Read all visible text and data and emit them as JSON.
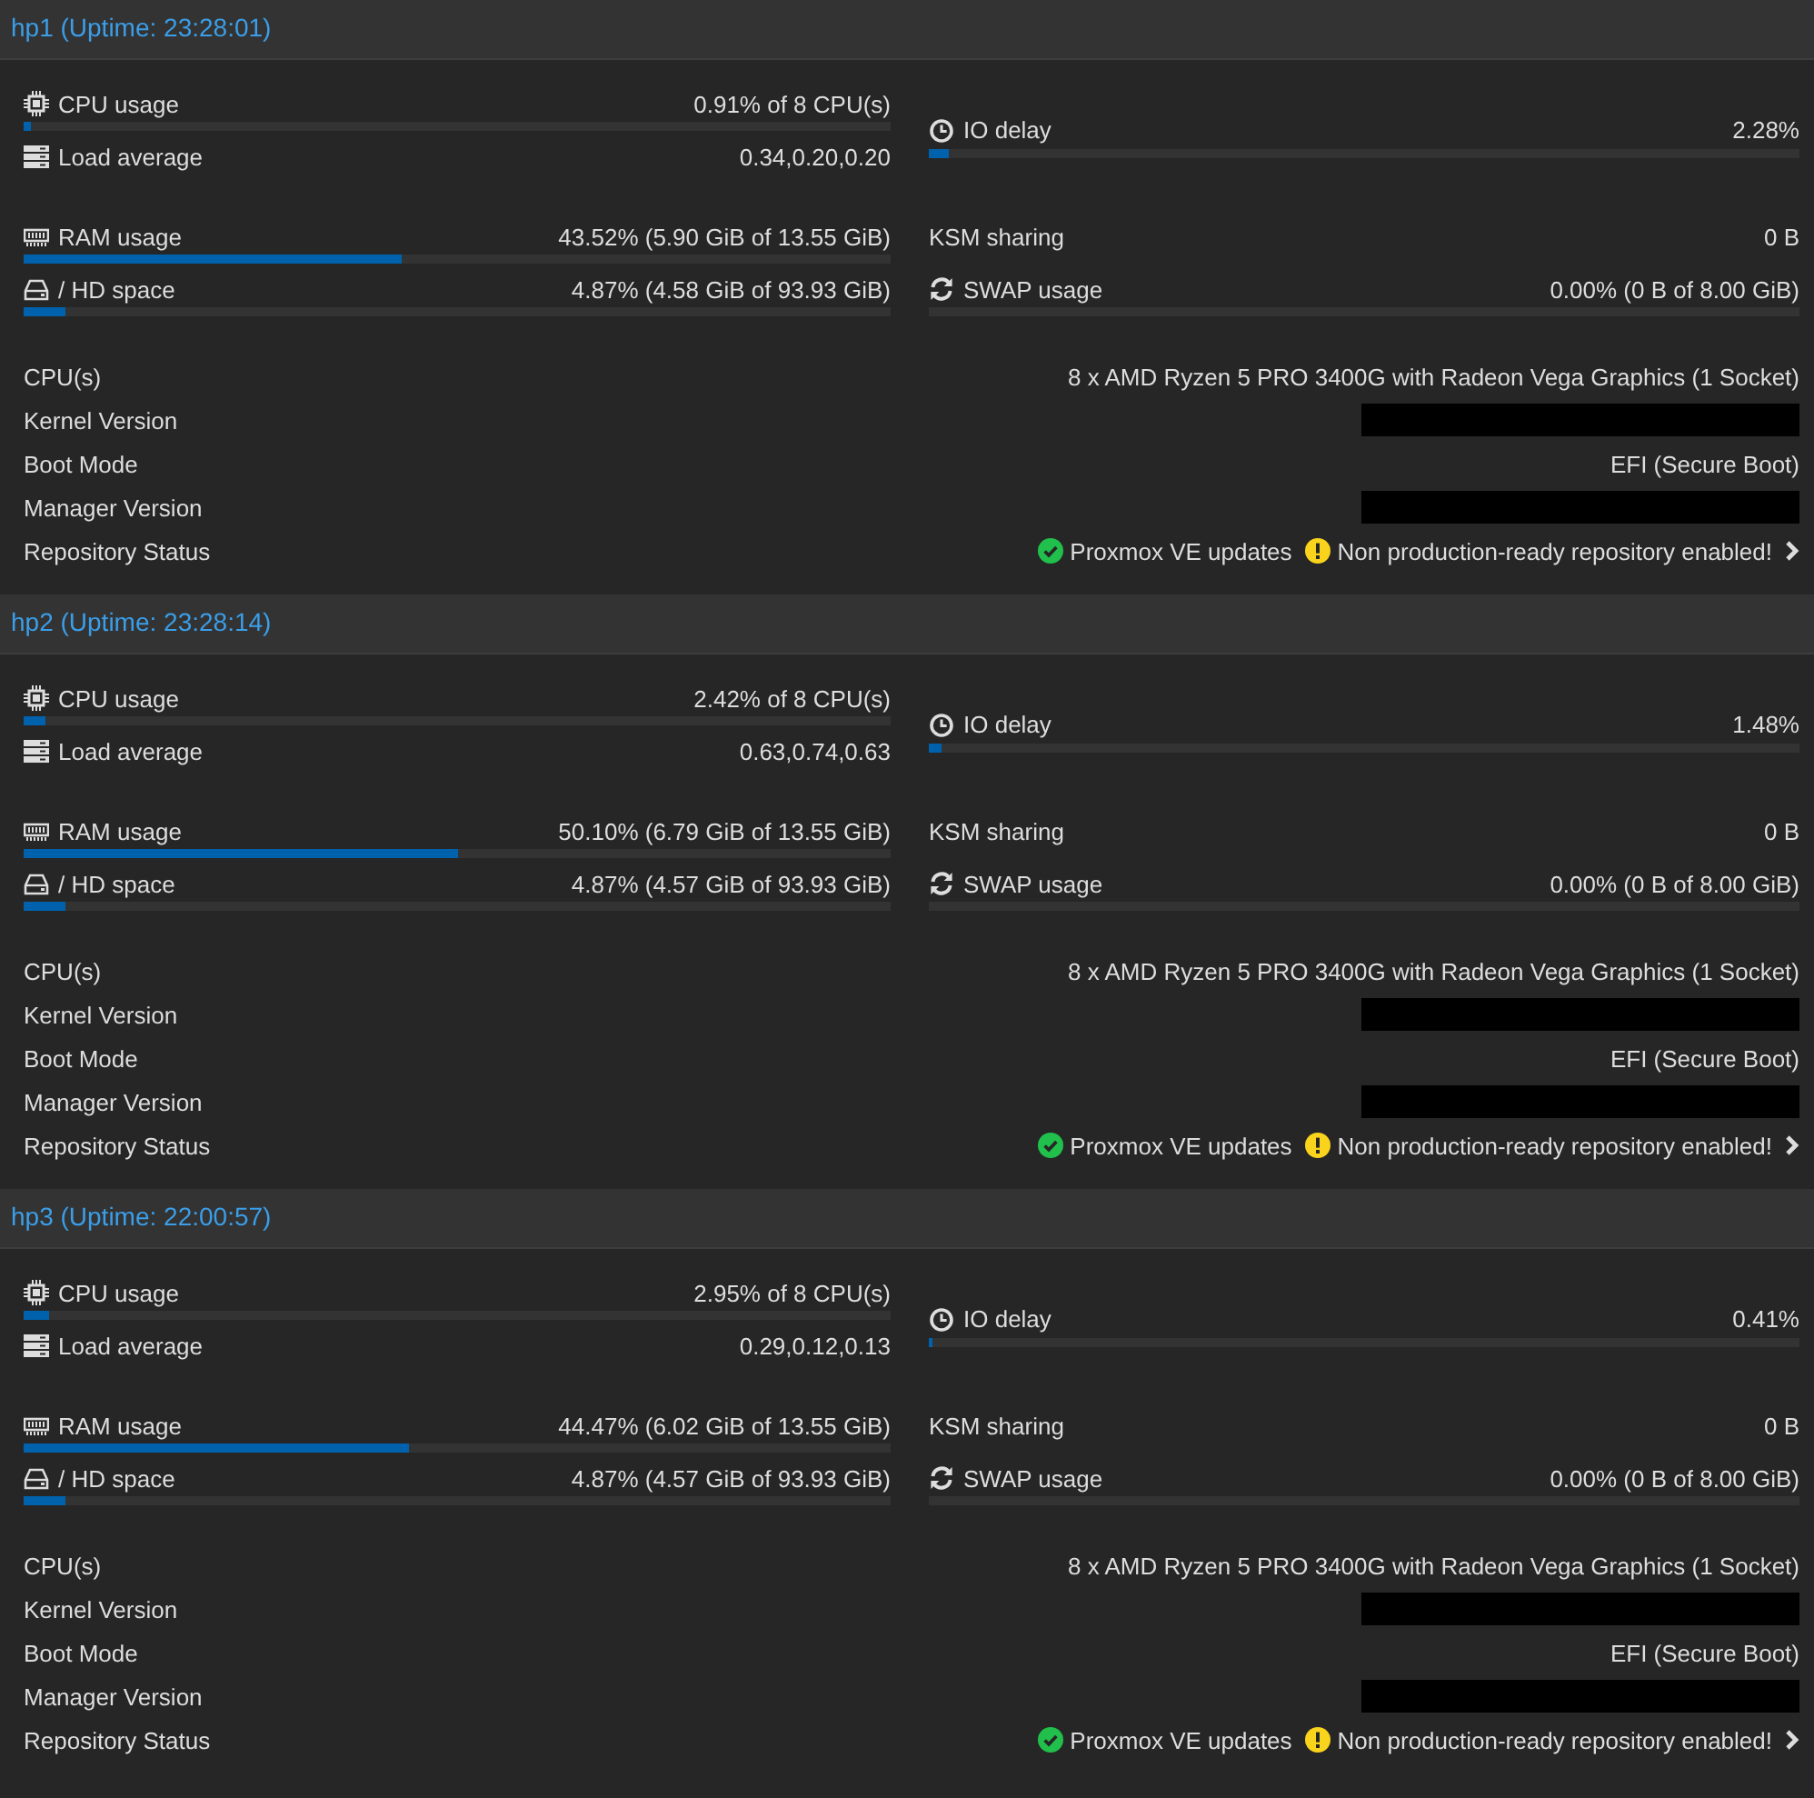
{
  "nodes": [
    {
      "title": "hp1 (Uptime: 23:28:01)",
      "cpu": {
        "label": "CPU usage",
        "value": "0.91% of 8 CPU(s)",
        "level": 0.0091
      },
      "load": {
        "label": "Load average",
        "value": "0.34,0.20,0.20"
      },
      "io": {
        "label": "IO delay",
        "value": "2.28%",
        "level": 0.0228
      },
      "ram": {
        "label": "RAM usage",
        "value": "43.52% (5.90 GiB of 13.55 GiB)",
        "level": 0.4352
      },
      "hd": {
        "label": "/ HD space",
        "value": "4.87% (4.58 GiB of 93.93 GiB)",
        "level": 0.0487
      },
      "ksm": {
        "label": "KSM sharing",
        "value": "0 B"
      },
      "swap": {
        "label": "SWAP usage",
        "value": "0.00% (0 B of 8.00 GiB)",
        "level": 0
      },
      "info": [
        {
          "kind": "text",
          "label": "CPU(s)",
          "value": "8 x AMD Ryzen 5 PRO 3400G with Radeon Vega Graphics (1 Socket)"
        },
        {
          "kind": "redacted",
          "label": "Kernel Version"
        },
        {
          "kind": "text",
          "label": "Boot Mode",
          "value": "EFI (Secure Boot)"
        },
        {
          "kind": "redacted",
          "label": "Manager Version"
        },
        {
          "kind": "repo",
          "label": "Repository Status",
          "items": [
            {
              "kind": "ok",
              "text": "Proxmox VE updates"
            },
            {
              "kind": "warning",
              "text": "Non production-ready repository enabled!"
            }
          ]
        }
      ]
    },
    {
      "title": "hp2 (Uptime: 23:28:14)",
      "cpu": {
        "label": "CPU usage",
        "value": "2.42% of 8 CPU(s)",
        "level": 0.0242
      },
      "load": {
        "label": "Load average",
        "value": "0.63,0.74,0.63"
      },
      "io": {
        "label": "IO delay",
        "value": "1.48%",
        "level": 0.0148
      },
      "ram": {
        "label": "RAM usage",
        "value": "50.10% (6.79 GiB of 13.55 GiB)",
        "level": 0.501
      },
      "hd": {
        "label": "/ HD space",
        "value": "4.87% (4.57 GiB of 93.93 GiB)",
        "level": 0.0487
      },
      "ksm": {
        "label": "KSM sharing",
        "value": "0 B"
      },
      "swap": {
        "label": "SWAP usage",
        "value": "0.00% (0 B of 8.00 GiB)",
        "level": 0
      },
      "info": [
        {
          "kind": "text",
          "label": "CPU(s)",
          "value": "8 x AMD Ryzen 5 PRO 3400G with Radeon Vega Graphics (1 Socket)"
        },
        {
          "kind": "redacted",
          "label": "Kernel Version"
        },
        {
          "kind": "text",
          "label": "Boot Mode",
          "value": "EFI (Secure Boot)"
        },
        {
          "kind": "redacted",
          "label": "Manager Version"
        },
        {
          "kind": "repo",
          "label": "Repository Status",
          "items": [
            {
              "kind": "ok",
              "text": "Proxmox VE updates"
            },
            {
              "kind": "warning",
              "text": "Non production-ready repository enabled!"
            }
          ]
        }
      ]
    },
    {
      "title": "hp3 (Uptime: 22:00:57)",
      "cpu": {
        "label": "CPU usage",
        "value": "2.95% of 8 CPU(s)",
        "level": 0.0295
      },
      "load": {
        "label": "Load average",
        "value": "0.29,0.12,0.13"
      },
      "io": {
        "label": "IO delay",
        "value": "0.41%",
        "level": 0.0041
      },
      "ram": {
        "label": "RAM usage",
        "value": "44.47% (6.02 GiB of 13.55 GiB)",
        "level": 0.4447
      },
      "hd": {
        "label": "/ HD space",
        "value": "4.87% (4.57 GiB of 93.93 GiB)",
        "level": 0.0487
      },
      "ksm": {
        "label": "KSM sharing",
        "value": "0 B"
      },
      "swap": {
        "label": "SWAP usage",
        "value": "0.00% (0 B of 8.00 GiB)",
        "level": 0
      },
      "info": [
        {
          "kind": "text",
          "label": "CPU(s)",
          "value": "8 x AMD Ryzen 5 PRO 3400G with Radeon Vega Graphics (1 Socket)"
        },
        {
          "kind": "redacted",
          "label": "Kernel Version"
        },
        {
          "kind": "text",
          "label": "Boot Mode",
          "value": "EFI (Secure Boot)"
        },
        {
          "kind": "redacted",
          "label": "Manager Version"
        },
        {
          "kind": "repo",
          "label": "Repository Status",
          "items": [
            {
              "kind": "ok",
              "text": "Proxmox VE updates"
            },
            {
              "kind": "warning",
              "text": "Non production-ready repository enabled!"
            }
          ]
        }
      ]
    }
  ]
}
